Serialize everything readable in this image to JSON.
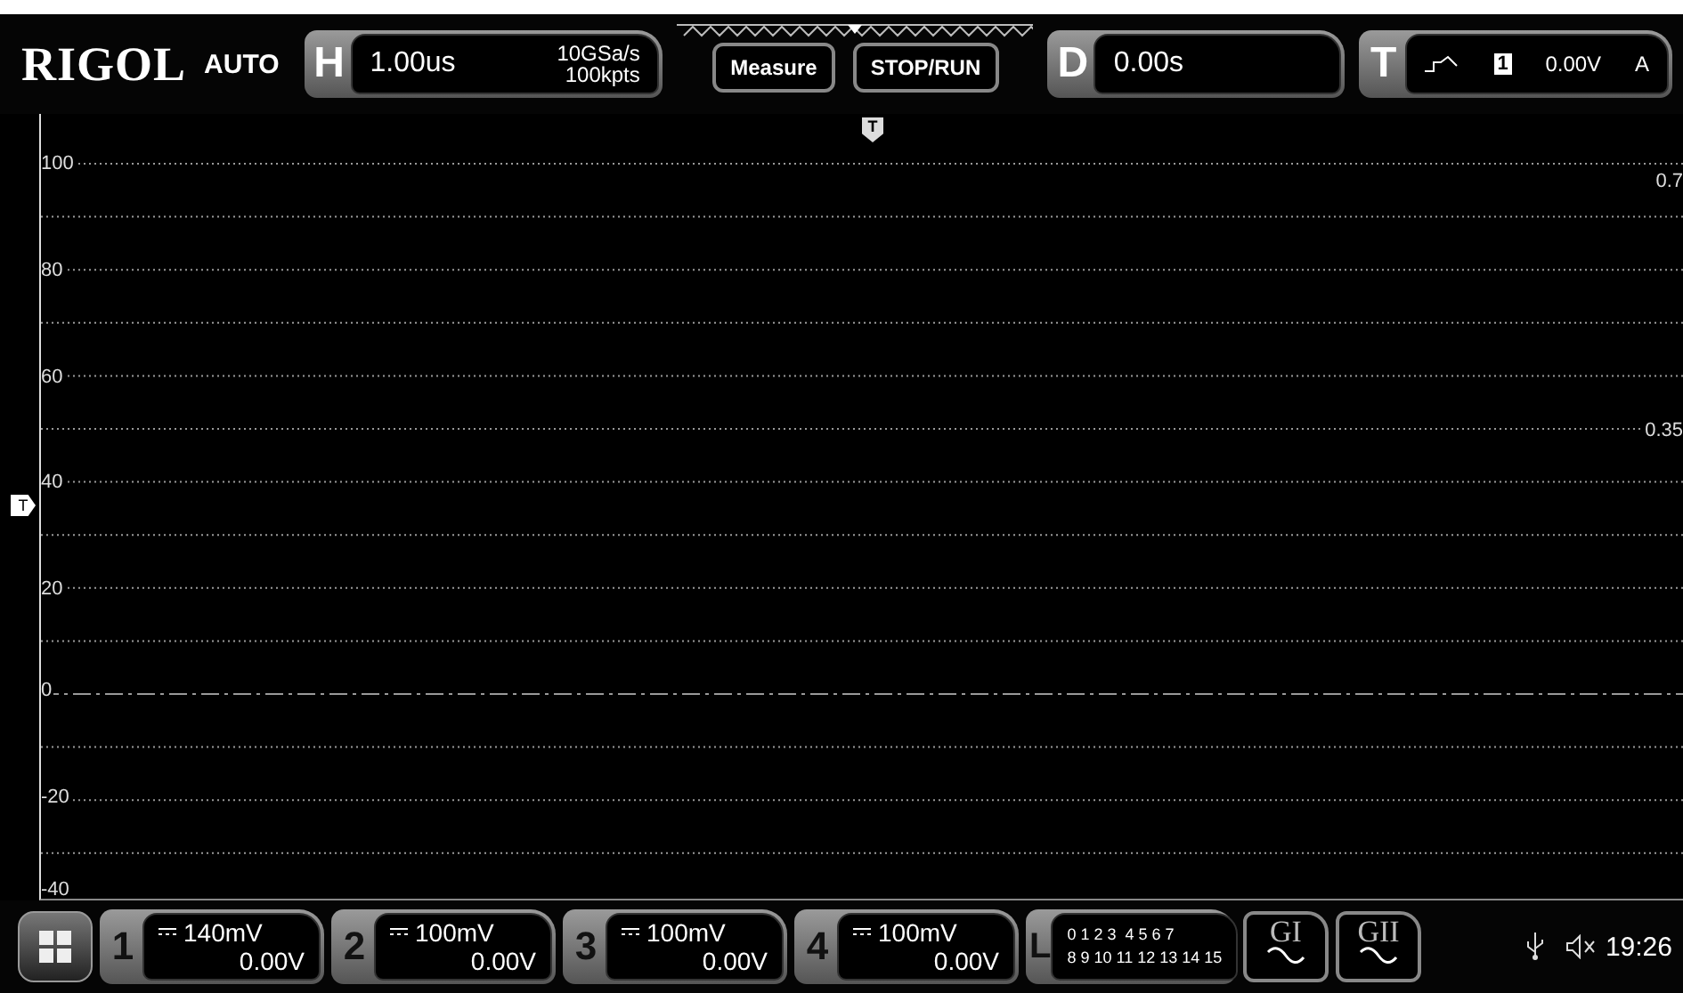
{
  "header": {
    "logo": "RIGOL",
    "mode": "AUTO",
    "horizontal": {
      "letter": "H",
      "timebase": "1.00us",
      "sample_rate": "10GSa/s",
      "memory_depth": "100kpts"
    },
    "buttons": [
      "Measure",
      "STOP/RUN"
    ],
    "delay": {
      "letter": "D",
      "value": "0.00s"
    },
    "trigger": {
      "letter": "T",
      "source": "1",
      "level": "0.00V",
      "mode": "A"
    }
  },
  "plot": {
    "trigger_position_marker": "T",
    "trigger_level_marker": "T",
    "left_axis": [
      "100",
      "80",
      "60",
      "40",
      "20",
      "0",
      "-20",
      "-40"
    ],
    "right_labels": [
      "0.7",
      "0.35"
    ]
  },
  "footer": {
    "channels": [
      {
        "number": "1",
        "scale": "140mV",
        "offset": "0.00V"
      },
      {
        "number": "2",
        "scale": "100mV",
        "offset": "0.00V"
      },
      {
        "number": "3",
        "scale": "100mV",
        "offset": "0.00V"
      },
      {
        "number": "4",
        "scale": "100mV",
        "offset": "0.00V"
      }
    ],
    "logic": {
      "letter": "L",
      "row_1": "0 1 2 3  4 5 6 7",
      "row_2": "8 9 10 11 12 13 14 15"
    },
    "generators": [
      "GI",
      "GII"
    ],
    "time": "19:26"
  }
}
